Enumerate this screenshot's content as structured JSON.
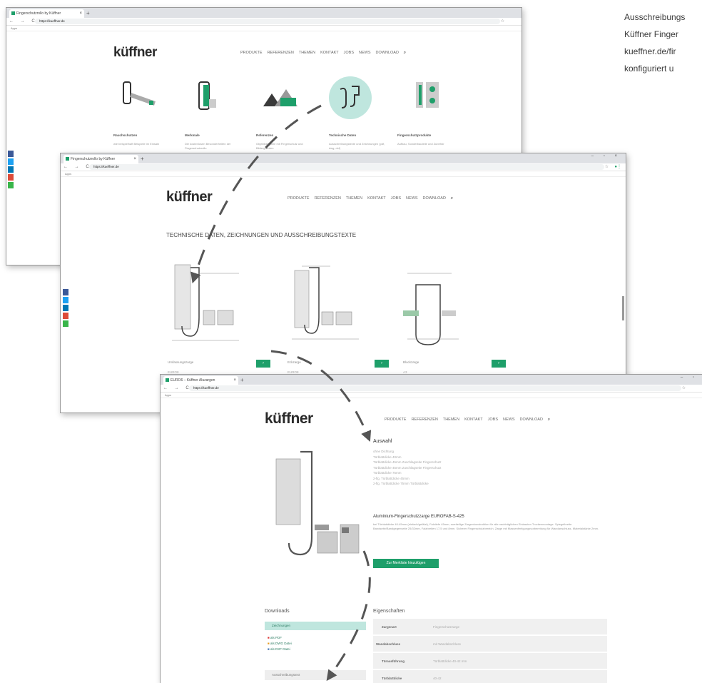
{
  "caption": {
    "lines": [
      "Ausschreibungs",
      "Küffner Finger",
      "kueffner.de/fir",
      "konfiguriert u"
    ]
  },
  "browser": {
    "tab_titles": [
      "Fingerschutzrollo by Küffner",
      "Fingerschutzrollo by Küffner",
      "EURO6 – Küffner Aluzargen"
    ],
    "url_host": "https://kueffner.de",
    "bookmarks_label": "Apps"
  },
  "site": {
    "logo": "küffner",
    "nav": [
      "PRODUKTE",
      "REFERENZEN",
      "THEMEN",
      "KONTAKT",
      "JOBS",
      "NEWS",
      "DOWNLOAD"
    ]
  },
  "window1": {
    "categories": [
      {
        "title": "Rauchschutzen",
        "desc": "wie beispielhaft Beispiele im Einsatz"
      },
      {
        "title": "Merkmale",
        "desc": "Die kostenlosen Besonderheiten der Fingerschutzrollo"
      },
      {
        "title": "Referenzen",
        "desc": "Objektbeispiele mit Fingerschutz und Bildergalerien"
      },
      {
        "title": "Technische Daten",
        "desc": "Ausschreibungstexte und Zeichnungen (pdf, dwg, dxf)"
      },
      {
        "title": "Fingerschutzprodukte",
        "desc": "Aufbau, Sonderbauteile und Zubehör"
      }
    ]
  },
  "window2": {
    "heading": "TECHNISCHE DATEN, ZEICHNUNGEN UND AUSSCHREIBUNGSTEXTE",
    "drawings": [
      {
        "label": "Umfassungszarge",
        "sub": "EURO8"
      },
      {
        "label": "Eckzarge",
        "sub": "EURO8"
      },
      {
        "label": "Blockzarge",
        "sub": "A3"
      }
    ],
    "go_button": "›"
  },
  "window3": {
    "section_title": "Auswahl",
    "options": [
      "ohne Dichtung",
      "Türblattdicke 40mm",
      "Türblattdicke 45mm Zuschlagseite Fingerschutz",
      "Türblattdicke 45mm Zuschlagseite Fingerschutz",
      "Türblattdicke 75mm",
      "2-flg. Türblattdicke 45mm",
      "2-flg. Türblattdicke 75mm Türblattdicke"
    ],
    "product_title": "Aluminium-Fingerschutzzarge EUROFAB-S-425",
    "product_desc": "bei Türblattdicke 40-45mm (einfach/gefälzt), Falztiefe 45mm, zweiteilige Zargenkonstruktion für alle nachträglichen Einbauten Trockenmontage. Spiegelbreite Bandseite/Bandgegenseite 25/32mm, Falzbreiten 17,5 und 8mm. Sicherer Fingerschutzbereich. Zarge mit Massenfertigungsvorbereitung für Wandanschluss. Materialstärke 2mm.",
    "merklist_button": "Zur Merkliste hinzufügen",
    "downloads_title": "Downloads",
    "downloads_item": "Zeichnungen",
    "files": [
      "als PDF",
      "als DWG Datei",
      "als DXF Datei"
    ],
    "downloads_next": "Ausschreibungstext",
    "properties_title": "Eigenschaften",
    "properties": [
      {
        "key": "Zargenart",
        "value": "Fingerschutzzarge"
      },
      {
        "key": "Wandabschluss",
        "value": "mit Wandabschluss"
      },
      {
        "key": "Türausführung",
        "value": "Türblattdicke 40-42 mm"
      },
      {
        "key": "Türblattdicke",
        "value": "40-42"
      }
    ]
  },
  "colors": {
    "accent": "#1e9f6a",
    "accent_light": "#bfe6de",
    "social": [
      "#3b5998",
      "#1da1f2",
      "#0077b5",
      "#dd4b39",
      "#39b54a"
    ]
  }
}
